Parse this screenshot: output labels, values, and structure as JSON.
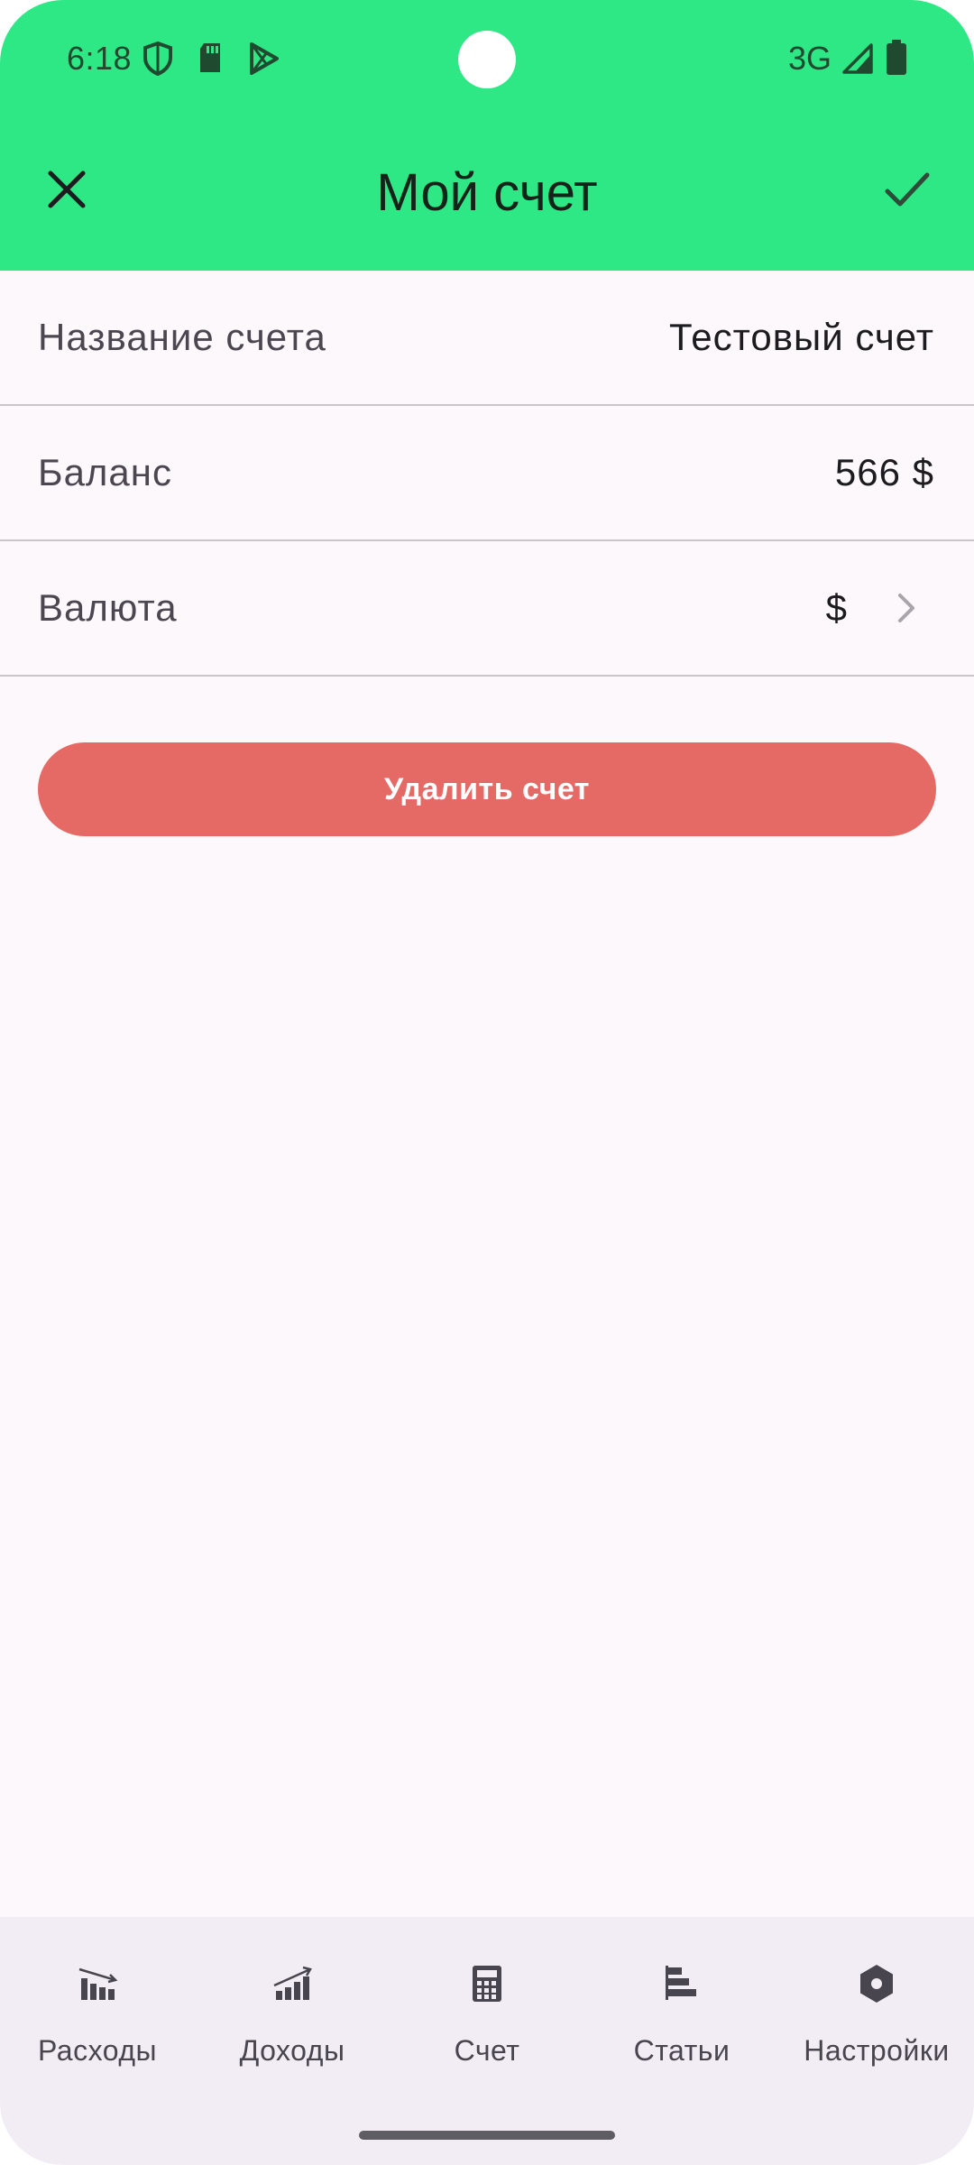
{
  "status_bar": {
    "time": "6:18",
    "network": "3G",
    "icons": [
      "shield-icon",
      "sd-card-icon",
      "play-store-icon",
      "signal-icon",
      "battery-icon"
    ]
  },
  "app_bar": {
    "title": "Мой счет",
    "close_icon": "close-icon",
    "confirm_icon": "check-icon",
    "background": "#2de884"
  },
  "form": {
    "account_name": {
      "label": "Название счета",
      "value": "Тестовый счет"
    },
    "balance": {
      "label": "Баланс",
      "value": "566 $"
    },
    "currency": {
      "label": "Валюта",
      "value": "$"
    }
  },
  "delete_button": {
    "label": "Удалить счет",
    "color": "#e56a65"
  },
  "bottom_nav": {
    "items": [
      {
        "label": "Расходы",
        "icon": "expenses-chart-icon"
      },
      {
        "label": "Доходы",
        "icon": "income-chart-icon"
      },
      {
        "label": "Счет",
        "icon": "calculator-icon"
      },
      {
        "label": "Статьи",
        "icon": "categories-icon"
      },
      {
        "label": "Настройки",
        "icon": "settings-hex-icon"
      }
    ]
  }
}
